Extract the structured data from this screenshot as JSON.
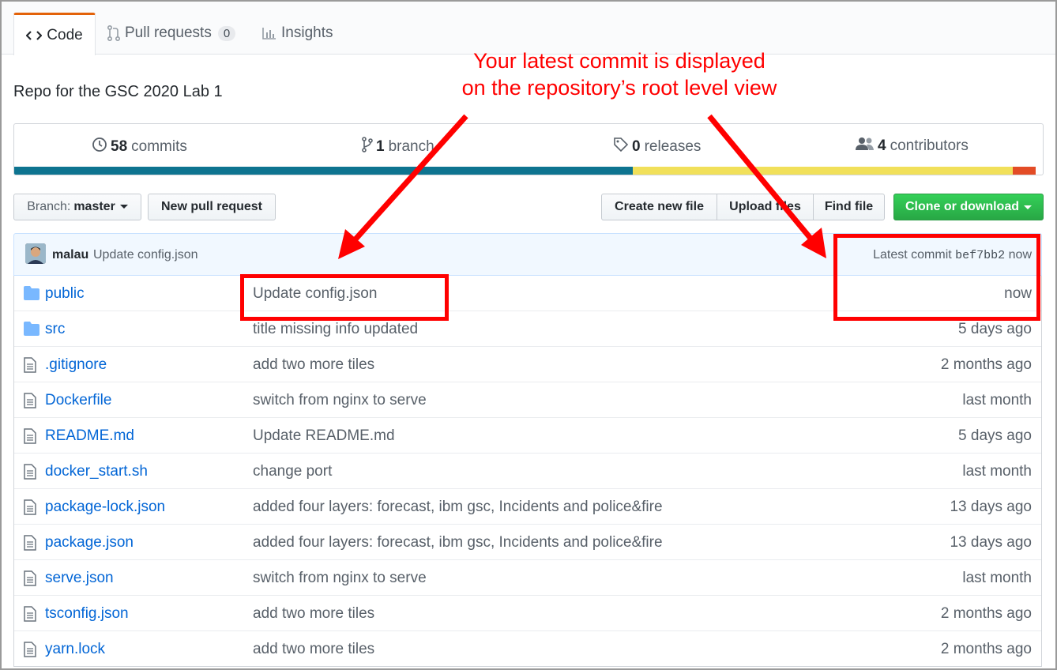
{
  "tabs": [
    {
      "label": "Code",
      "icon": "code-icon"
    },
    {
      "label": "Pull requests",
      "icon": "git-pull-request-icon",
      "count": "0"
    },
    {
      "label": "Insights",
      "icon": "graph-icon"
    }
  ],
  "repo": {
    "description": "Repo for the GSC 2020 Lab 1"
  },
  "summary": {
    "commits_count": "58",
    "commits_label": "commits",
    "branches_count": "1",
    "branches_label": "branch",
    "releases_count": "0",
    "releases_label": "releases",
    "contributors_count": "4",
    "contributors_label": "contributors"
  },
  "language_bar": [
    {
      "color": "#0e7490",
      "share": 0.601
    },
    {
      "color": "#f1e05a",
      "share": 0.37
    },
    {
      "color": "#e34c26",
      "share": 0.022
    }
  ],
  "toolbar": {
    "branch_prefix": "Branch:",
    "branch_name": "master",
    "new_pull_request": "New pull request",
    "create_new_file": "Create new file",
    "upload_files": "Upload files",
    "find_file": "Find file",
    "clone_or_download": "Clone or download"
  },
  "latest_commit": {
    "author": "malau",
    "message": "Update config.json",
    "prefix": "Latest commit",
    "sha": "bef7bb2",
    "age": "now"
  },
  "files": [
    {
      "type": "dir",
      "name": "public",
      "message": "Update config.json",
      "age": "now"
    },
    {
      "type": "dir",
      "name": "src",
      "message": "title missing info updated",
      "age": "5 days ago"
    },
    {
      "type": "file",
      "name": ".gitignore",
      "message": "add two more tiles",
      "age": "2 months ago"
    },
    {
      "type": "file",
      "name": "Dockerfile",
      "message": "switch from nginx to serve",
      "age": "last month"
    },
    {
      "type": "file",
      "name": "README.md",
      "message": "Update README.md",
      "age": "5 days ago"
    },
    {
      "type": "file",
      "name": "docker_start.sh",
      "message": "change port",
      "age": "last month"
    },
    {
      "type": "file",
      "name": "package-lock.json",
      "message": "added four layers: forecast, ibm gsc, Incidents and police&fire",
      "age": "13 days ago"
    },
    {
      "type": "file",
      "name": "package.json",
      "message": "added four layers: forecast, ibm gsc, Incidents and police&fire",
      "age": "13 days ago"
    },
    {
      "type": "file",
      "name": "serve.json",
      "message": "switch from nginx to serve",
      "age": "last month"
    },
    {
      "type": "file",
      "name": "tsconfig.json",
      "message": "add two more tiles",
      "age": "2 months ago"
    },
    {
      "type": "file",
      "name": "yarn.lock",
      "message": "add two more tiles",
      "age": "2 months ago"
    }
  ],
  "annotation": {
    "line1": "Your latest commit is displayed",
    "line2": "on the repository’s root level view",
    "color": "#ff0000"
  }
}
